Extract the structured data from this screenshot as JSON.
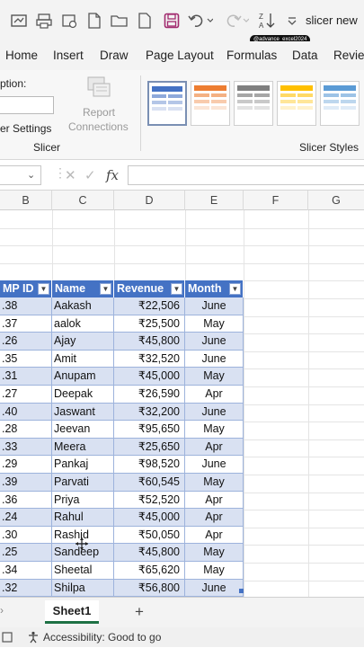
{
  "window": {
    "title": "slicer new",
    "watermark": "@advance_excel2024"
  },
  "ribbon_tabs": [
    "Home",
    "Insert",
    "Draw",
    "Page Layout",
    "Formulas",
    "Data",
    "Review"
  ],
  "ribbon": {
    "caption_label": "ption:",
    "settings_label": "er Settings",
    "report_connections_line1": "Report",
    "report_connections_line2": "Connections",
    "group_slicer": "Slicer",
    "group_slicer_styles": "Slicer Styles"
  },
  "formula_bar": {
    "name_box_value": "",
    "cancel_icon": "✕",
    "enter_icon": "✓",
    "fx_label": "fx",
    "formula_value": ""
  },
  "column_headers": [
    "B",
    "C",
    "D",
    "E",
    "F",
    "G"
  ],
  "table": {
    "headers": [
      "MP ID",
      "Name",
      "Revenue",
      "Month"
    ],
    "rows": [
      [
        ".38",
        "Aakash",
        "₹22,506",
        "June"
      ],
      [
        ".37",
        "aalok",
        "₹25,500",
        "May"
      ],
      [
        ".26",
        "Ajay",
        "₹45,800",
        "June"
      ],
      [
        ".35",
        "Amit",
        "₹32,520",
        "June"
      ],
      [
        ".31",
        "Anupam",
        "₹45,000",
        "May"
      ],
      [
        ".27",
        "Deepak",
        "₹26,590",
        "Apr"
      ],
      [
        ".40",
        "Jaswant",
        "₹32,200",
        "June"
      ],
      [
        ".28",
        "Jeevan",
        "₹95,650",
        "May"
      ],
      [
        ".33",
        "Meera",
        "₹25,650",
        "Apr"
      ],
      [
        ".29",
        "Pankaj",
        "₹98,520",
        "June"
      ],
      [
        ".39",
        "Parvati",
        "₹60,545",
        "May"
      ],
      [
        ".36",
        "Priya",
        "₹52,520",
        "Apr"
      ],
      [
        ".24",
        "Rahul",
        "₹45,000",
        "Apr"
      ],
      [
        ".30",
        "Rashid",
        "₹50,050",
        "Apr"
      ],
      [
        ".25",
        "Sandeep",
        "₹45,800",
        "May"
      ],
      [
        ".34",
        "Sheetal",
        "₹65,620",
        "May"
      ],
      [
        ".32",
        "Shilpa",
        "₹56,800",
        "June"
      ]
    ]
  },
  "sheets": {
    "active": "Sheet1",
    "add_label": "+"
  },
  "status": {
    "accessibility": "Accessibility: Good to go"
  },
  "colors": {
    "table_header": "#4472c4",
    "band": "#d9e1f2",
    "sheet_accent": "#1e7145"
  }
}
